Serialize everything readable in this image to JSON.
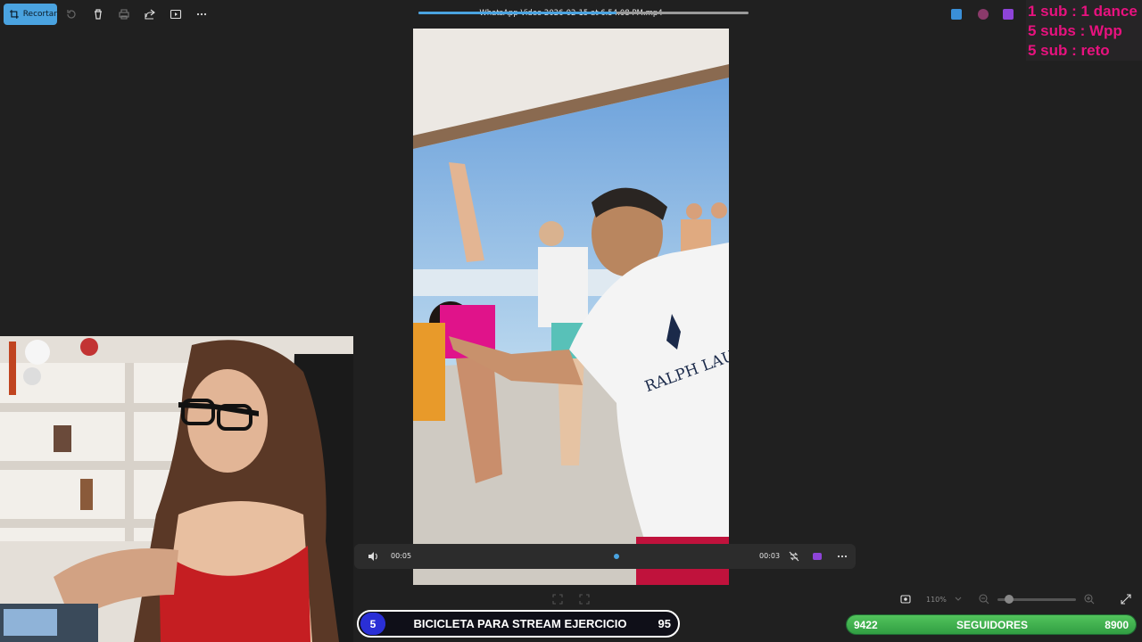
{
  "toolbar": {
    "crop_label": "Recortar",
    "file_title": "WhatsApp Video 2026-02-15 at 6.54.08 PM.mp4"
  },
  "overlay_rules": {
    "lines": [
      "1 sub : 1 dance",
      "5 subs : Wpp",
      "5 sub : reto"
    ],
    "color": "#e8127f"
  },
  "video_frame": {
    "shirt_text": "RALPH LAUREN"
  },
  "player": {
    "elapsed": "00:05",
    "remaining": "00:03",
    "progress": 0.6,
    "accent": "#4aa3e0"
  },
  "statusbar": {
    "zoom": "110%",
    "zoom_level": 0.15
  },
  "goal_bar": {
    "current": "5",
    "label": "BICICLETA PARA STREAM EJERCICIO",
    "target": "95",
    "fraction": 0.053,
    "color": "#2a2fd6"
  },
  "followers_bar": {
    "current": "9422",
    "label": "SEGUIDORES",
    "target": "8900",
    "fraction": 1.0,
    "color": "#3fae4c"
  }
}
